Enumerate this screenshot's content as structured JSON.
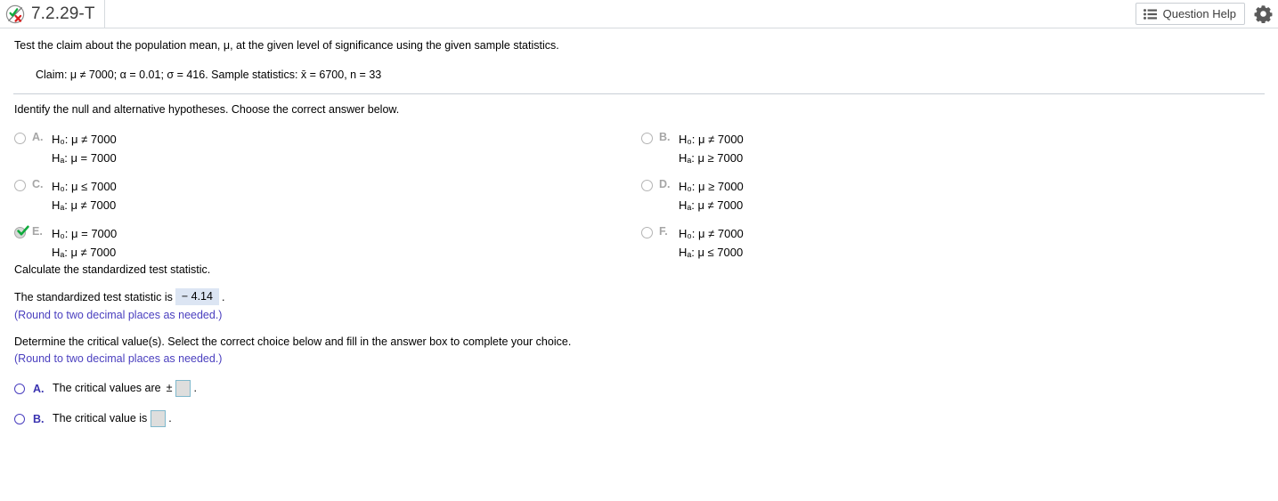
{
  "header": {
    "status_icon": "check-x-circle-icon",
    "exercise_title": "7.2.29-T",
    "question_help_label": "Question Help",
    "question_help_icon": "list-icon",
    "settings_icon": "gear-icon"
  },
  "problem": {
    "prompt": "Test the claim about the population mean, μ, at the given level of significance using the given sample statistics.",
    "claim": "Claim: μ ≠ 7000; α = 0.01; σ = 416. Sample statistics: x̄ = 6700, n = 33"
  },
  "hypotheses_section": {
    "question": "Identify the null and alternative hypotheses. Choose the correct answer below.",
    "options": [
      {
        "letter": "A.",
        "null": "H₀: μ ≠ 7000",
        "alt": "Hₐ: μ = 7000",
        "selected": false,
        "column": "left"
      },
      {
        "letter": "B.",
        "null": "H₀: μ ≠ 7000",
        "alt": "Hₐ: μ ≥ 7000",
        "selected": false,
        "column": "right"
      },
      {
        "letter": "C.",
        "null": "H₀: μ ≤ 7000",
        "alt": "Hₐ: μ ≠ 7000",
        "selected": false,
        "column": "left"
      },
      {
        "letter": "D.",
        "null": "H₀: μ ≥ 7000",
        "alt": "Hₐ: μ ≠ 7000",
        "selected": false,
        "column": "right"
      },
      {
        "letter": "E.",
        "null": "H₀: μ = 7000",
        "alt": "Hₐ: μ ≠ 7000",
        "selected": true,
        "column": "left"
      },
      {
        "letter": "F.",
        "null": "H₀: μ ≠ 7000",
        "alt": "Hₐ: μ ≤ 7000",
        "selected": false,
        "column": "right"
      }
    ]
  },
  "test_statistic_section": {
    "instruction": "Calculate the standardized test statistic.",
    "label_before": "The standardized test statistic is",
    "value": "− 4.14",
    "label_after": ".",
    "round_note": "(Round to two decimal places as needed.)"
  },
  "critical_value_section": {
    "instruction": "Determine the critical value(s). Select the correct choice below and fill in the answer box to complete your choice.",
    "round_note": "(Round to two decimal places as needed.)",
    "choices": [
      {
        "letter": "A.",
        "text_before": "The critical values are",
        "symbol": "±",
        "input_value": "",
        "text_after": "."
      },
      {
        "letter": "B.",
        "text_before": "The critical value is",
        "symbol": "",
        "input_value": "",
        "text_after": "."
      }
    ]
  },
  "colors": {
    "note_purple": "#4a3fbf",
    "answered_fill": "#dce5f3",
    "input_border": "#7fb8cc",
    "input_fill": "#dededd",
    "disabled_gray": "#a6a6a6",
    "check_green": "#0faa3c",
    "x_red": "#d91f1f"
  }
}
